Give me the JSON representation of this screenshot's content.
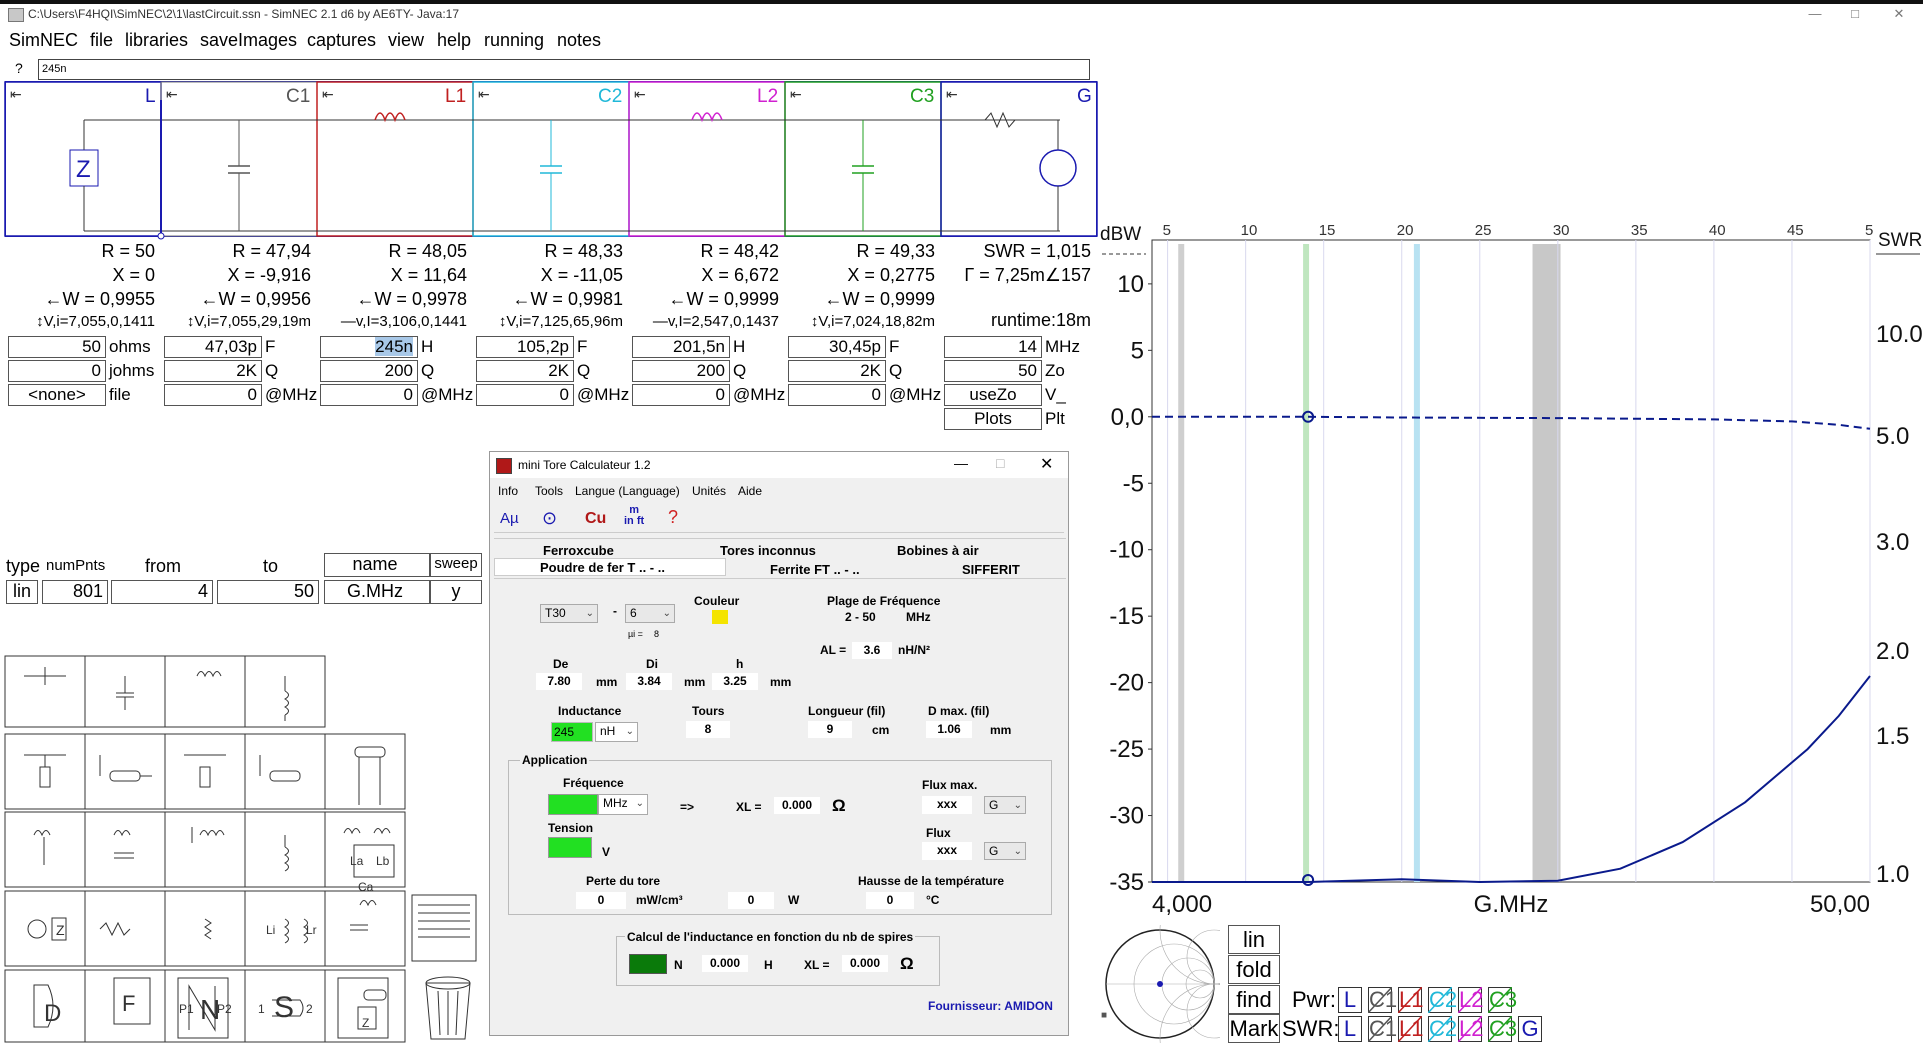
{
  "window": {
    "title": "C:\\Users\\F4HQI\\SimNEC\\2\\1\\lastCircuit.ssn - SimNEC 2.1 d6 by AE6TY-     Java:17"
  },
  "menu": [
    "SimNEC",
    "file",
    "libraries",
    "saveImages",
    "captures",
    "view",
    "help",
    "running",
    "notes"
  ],
  "cmd": {
    "prompt": "?",
    "value": "245n"
  },
  "sections": [
    {
      "label": "L",
      "color": "#1a1ab0",
      "R": "R = 50",
      "X": "X = 0",
      "W": "←W = 0,9955",
      "V": "↕V,i=7,055,0,1411",
      "v1": "50",
      "u1": "ohms",
      "v2": "0",
      "u2": "johms",
      "v3": "<none>",
      "u3": "file"
    },
    {
      "label": "C1",
      "color": "#555555",
      "R": "R = 47,94",
      "X": "X = -9,916",
      "W": "←W = 0,9956",
      "V": "↕V,i=7,055,29,19m",
      "v1": "47,03p",
      "u1": "F",
      "v2": "2K",
      "u2": "Q",
      "v3": "0",
      "u3": "@MHz"
    },
    {
      "label": "L1",
      "color": "#c02020",
      "R": "R = 48,05",
      "X": "X = 11,64",
      "W": "←W = 0,9978",
      "V": "—v,I=3,106,0,1441",
      "v1": "245n",
      "u1": "H",
      "v2": "200",
      "u2": "Q",
      "v3": "0",
      "u3": "@MHz"
    },
    {
      "label": "C2",
      "color": "#20b8d8",
      "R": "R = 48,33",
      "X": "X = -11,05",
      "W": "←W = 0,9981",
      "V": "↕V,i=7,125,65,96m",
      "v1": "105,2p",
      "u1": "F",
      "v2": "2K",
      "u2": "Q",
      "v3": "0",
      "u3": "@MHz"
    },
    {
      "label": "L2",
      "color": "#d020d0",
      "R": "R = 48,42",
      "X": "X = 6,672",
      "W": "←W = 0,9999",
      "V": "—v,I=2,547,0,1437",
      "v1": "201,5n",
      "u1": "H",
      "v2": "200",
      "u2": "Q",
      "v3": "0",
      "u3": "@MHz"
    },
    {
      "label": "C3",
      "color": "#20a020",
      "R": "R = 49,33",
      "X": "X = 0,2775",
      "W": "←W = 0,9999",
      "V": "↕V,i=7,024,18,82m",
      "v1": "30,45p",
      "u1": "F",
      "v2": "2K",
      "u2": "Q",
      "v3": "0",
      "u3": "@MHz"
    },
    {
      "label": "G",
      "color": "#1a1ab0",
      "R": "SWR = 1,015",
      "X": "Γ = 7,25m∠157",
      "W": "",
      "V": "runtime:18m",
      "v1": "14",
      "u1": "MHz",
      "v2": "50",
      "u2": "Zo",
      "v3": "useZo",
      "u3": "V_",
      "v4": "Plots",
      "u4": "Plt"
    }
  ],
  "sweep": {
    "h_type": "type",
    "h_num": "numPnts",
    "h_from": "from",
    "h_to": "to",
    "h_name": "name",
    "h_sweep": "sweep",
    "type": "lin",
    "num": "801",
    "from": "4",
    "to": "50",
    "name": "G.MHz",
    "sweep": "y"
  },
  "palette_labels": {
    "la": "La",
    "lb": "Lb",
    "ca": "Ca",
    "lr": "Lr",
    "li": "Li",
    "z": "Z",
    "d": "D",
    "f": "F",
    "n": "N",
    "s": "S",
    "p1": "P1",
    "p2": "P2",
    "one": "1",
    "two": "2"
  },
  "dialog": {
    "title": "mini Tore Calculateur 1.2",
    "menus": [
      "Info",
      "Tools",
      "Langue (Language)",
      "Unités",
      "Aide"
    ],
    "toolbar": [
      "Aµ",
      "⊙",
      "Cu",
      "m\nin ft",
      "?"
    ],
    "tabs_row1": [
      "Ferroxcube",
      "Tores inconnus",
      "Bobines à air"
    ],
    "tabs_row2": [
      "Poudre de fer T .. - ..",
      "Ferrite FT .. - ..",
      "SIFFERIT"
    ],
    "core_type": "T30",
    "mix": "6",
    "mu_label": "µi =",
    "mu": "8",
    "couleur_label": "Couleur",
    "couleur": "#f4e400",
    "plage_label": "Plage de Fréquence",
    "plage": "2 - 50",
    "plage_unit": "MHz",
    "al_label": "AL =",
    "al": "3.6",
    "al_unit": "nH/N²",
    "de_label": "De",
    "de": "7.80",
    "di_label": "Di",
    "di": "3.84",
    "h_label": "h",
    "h": "3.25",
    "mm": "mm",
    "ind_label": "Inductance",
    "ind": "245",
    "ind_unit": "nH",
    "tours_label": "Tours",
    "tours": "8",
    "long_label": "Longueur (fil)",
    "long": "9",
    "long_unit": "cm",
    "dmax_label": "D max. (fil)",
    "dmax": "1.06",
    "dmax_unit": "mm",
    "app_label": "Application",
    "freq_label": "Fréquence",
    "freq_unit": "MHz",
    "arrow": "=>",
    "xl_label": "XL =",
    "xl": "0.000",
    "ohm": "Ω",
    "fluxmax_label": "Flux max.",
    "fluxmax": "xxx",
    "flux_unit": "G",
    "tension_label": "Tension",
    "tension_unit": "V",
    "flux_label": "Flux",
    "flux": "xxx",
    "perte_label": "Perte du tore",
    "perte": "0",
    "perte_unit": "mW/cm³",
    "perte_w": "0",
    "w": "W",
    "hausse_label": "Hausse de la température",
    "hausse": "0",
    "degc": "°C",
    "calc_label": "Calcul de l'inductance en fonction du nb de spires",
    "calc_n": "N",
    "calc_h": "0.000",
    "calc_hu": "H",
    "calc_xl_label": "XL =",
    "calc_xl": "0.000",
    "supplier": "Fournisseur: AMIDON"
  },
  "chart_data": {
    "type": "line",
    "title": "",
    "xlabel": "G.MHz",
    "left_axis_label": "dBW",
    "right_axis_label": "SWR",
    "xlim": [
      4,
      50
    ],
    "x_tick_labels_top": [
      "5",
      "10",
      "15",
      "20",
      "25",
      "30",
      "35",
      "40",
      "45",
      "5"
    ],
    "x_tick_values_top": [
      5,
      10,
      15,
      20,
      25,
      30,
      35,
      40,
      45,
      50
    ],
    "x_end_labels": [
      "4,000",
      "G.MHz",
      "50,00"
    ],
    "ylim_left": [
      -35,
      13
    ],
    "y_left_ticks": [
      10,
      5,
      0,
      -5,
      -10,
      -15,
      -20,
      -25,
      -30,
      -35
    ],
    "y_left_tick_labels": [
      "10",
      "5",
      "0,0",
      "-5",
      "-10",
      "-15",
      "-20",
      "-25",
      "-30",
      "-35"
    ],
    "y_right_ticks": [
      "10.0",
      "5.0",
      "3.0",
      "2.0",
      "1.5",
      "1.0"
    ],
    "series": [
      {
        "style": "dashed",
        "color": "#0a1a8c",
        "x": [
          4,
          10,
          14,
          20,
          30,
          40,
          45,
          48,
          50
        ],
        "y": [
          0,
          0,
          0,
          -0.05,
          -0.1,
          -0.2,
          -0.35,
          -0.6,
          -0.9
        ]
      },
      {
        "style": "solid",
        "color": "#0a1a8c",
        "x": [
          4,
          10,
          14,
          20,
          25,
          30,
          34,
          38,
          42,
          46,
          48,
          50
        ],
        "y": [
          -35,
          -35,
          -35,
          -34.8,
          -35,
          -34.9,
          -34,
          -32,
          -29,
          -25,
          -22.5,
          -19.5
        ]
      }
    ],
    "marker_x": 14,
    "band_markers": [
      {
        "x": 6,
        "color": "#cfcfcf"
      },
      {
        "x": 14,
        "color": "#bfe6bf"
      },
      {
        "x": 21.1,
        "color": "#b8e2f2"
      },
      {
        "x": 28.7,
        "color": "#c8c8c8"
      }
    ]
  },
  "plot_buttons": [
    "lin",
    "fold",
    "find",
    "Mark"
  ],
  "legend": {
    "pwr_label": "Pwr:",
    "swr_label": "SWR:",
    "pwr": [
      {
        "t": "L",
        "c": "#1a1ab0"
      },
      {
        "t": "C1",
        "c": "#555555"
      },
      {
        "t": "L1",
        "c": "#c02020"
      },
      {
        "t": "C2",
        "c": "#20b8d8"
      },
      {
        "t": "L2",
        "c": "#d020d0"
      },
      {
        "t": "C3",
        "c": "#20a020"
      }
    ],
    "swr": [
      {
        "t": "L",
        "c": "#1a1ab0"
      },
      {
        "t": "C1",
        "c": "#555555"
      },
      {
        "t": "L1",
        "c": "#c02020"
      },
      {
        "t": "C2",
        "c": "#20b8d8"
      },
      {
        "t": "L2",
        "c": "#d020d0"
      },
      {
        "t": "C3",
        "c": "#20a020"
      },
      {
        "t": "G",
        "c": "#1a1ab0"
      }
    ]
  }
}
